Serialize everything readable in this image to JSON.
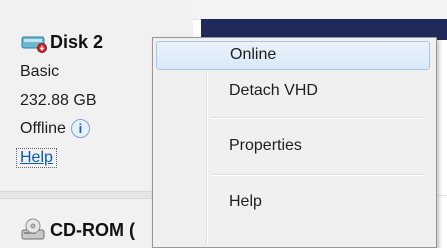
{
  "disk": {
    "title": "Disk 2",
    "type": "Basic",
    "size": "232.88 GB",
    "status": "Offline",
    "help_link": "Help",
    "info_icon": "info-icon"
  },
  "cdrom": {
    "title": "CD-ROM ("
  },
  "context_menu": {
    "items": [
      {
        "label": "Online"
      },
      {
        "label": "Detach VHD"
      },
      {
        "label": "Properties"
      },
      {
        "label": "Help"
      }
    ]
  },
  "colors": {
    "selected_bar": "#1f2a5a",
    "link": "#0b59b8",
    "hover_border": "#a9c6ea"
  }
}
